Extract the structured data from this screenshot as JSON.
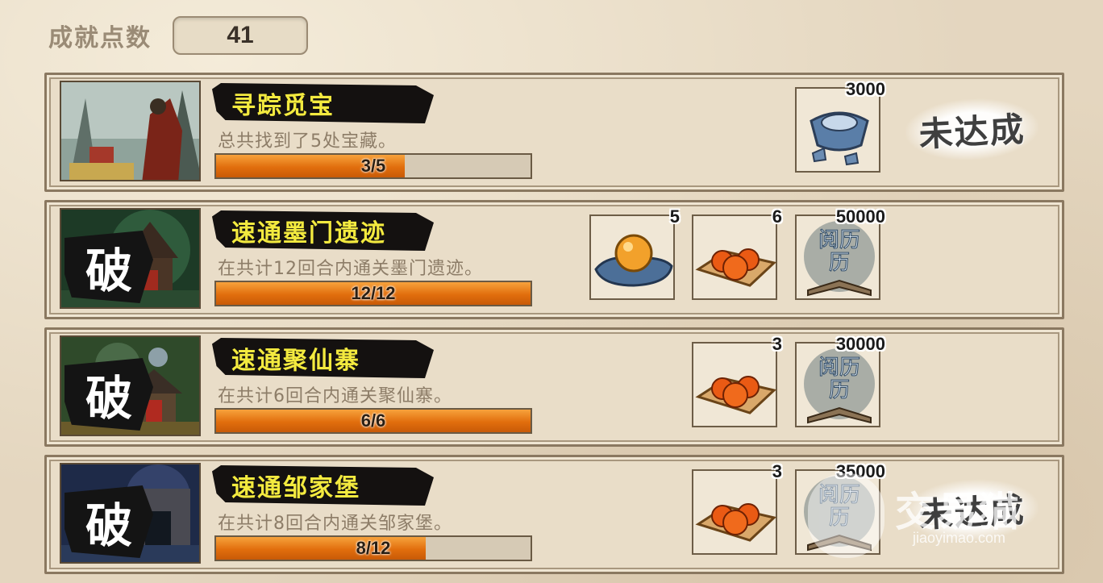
{
  "header": {
    "label": "成就点数",
    "points": "41"
  },
  "achievements": [
    {
      "title": "寻踪觅宝",
      "description": "总共找到了5处宝藏。",
      "progress_text": "3/5",
      "progress": 0.6,
      "broken": false,
      "rewards": [
        {
          "count": "3000",
          "icon": "silver-ingot-icon"
        }
      ],
      "status": "未达成"
    },
    {
      "title": "速通墨门遗迹",
      "description": "在共计12回合内通关墨门遗迹。",
      "progress_text": "12/12",
      "progress": 1.0,
      "broken": true,
      "badge": "破",
      "rewards": [
        {
          "count": "5",
          "icon": "golden-orb-icon"
        },
        {
          "count": "6",
          "icon": "orange-fruit-tray-icon"
        },
        {
          "count": "50000",
          "icon": "experience-book-icon",
          "label": "阅历"
        }
      ]
    },
    {
      "title": "速通聚仙寨",
      "description": "在共计6回合内通关聚仙寨。",
      "progress_text": "6/6",
      "progress": 1.0,
      "broken": true,
      "badge": "破",
      "rewards": [
        {
          "count": "3",
          "icon": "orange-fruit-tray-icon"
        },
        {
          "count": "30000",
          "icon": "experience-book-icon",
          "label": "阅历"
        }
      ]
    },
    {
      "title": "速通邹家堡",
      "description": "在共计8回合内通关邹家堡。",
      "progress_text": "8/12",
      "progress": 0.667,
      "broken": true,
      "badge": "破",
      "rewards": [
        {
          "count": "3",
          "icon": "orange-fruit-tray-icon"
        },
        {
          "count": "35000",
          "icon": "experience-book-icon",
          "label": "阅历"
        }
      ],
      "status": "未达成"
    }
  ],
  "watermark": {
    "text": "交易猫",
    "url": "jiaoyimao.com"
  }
}
